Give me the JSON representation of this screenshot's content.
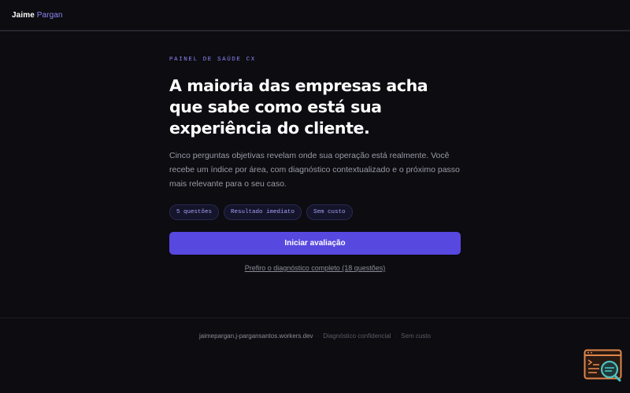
{
  "header": {
    "brand_first": "Jaime",
    "brand_last": "Pargan"
  },
  "hero": {
    "eyebrow": "PAINEL DE SAÚDE CX",
    "headline": "A maioria das empresas acha que sabe como está sua experiência do cliente.",
    "lead": "Cinco perguntas objetivas revelam onde sua operação está realmente. Você recebe um índice por área, com diagnóstico contextualizado e o próximo passo mais relevante para o seu caso.",
    "chips": [
      "5 questões",
      "Resultado imediato",
      "Sem custo"
    ],
    "cta_label": "Iniciar avaliação",
    "alt_link": "Prefiro o diagnóstico completo (18 questões)"
  },
  "footer": {
    "domain": "jaimepargan.j-pargansantos.workers.dev",
    "item_2": "Diagnóstico confidencial",
    "item_3": "Sem custo",
    "separator": "·"
  },
  "widget": {
    "icon": "terminal-search-icon",
    "colors": {
      "frame": "#e0864a",
      "lens": "#1f3a3a",
      "lens_ring": "#4ec2c2"
    }
  },
  "colors": {
    "background": "#0c0c11",
    "accent": "#5748e0",
    "accent_text": "#8f86f5",
    "chip_bg": "#14142a"
  }
}
